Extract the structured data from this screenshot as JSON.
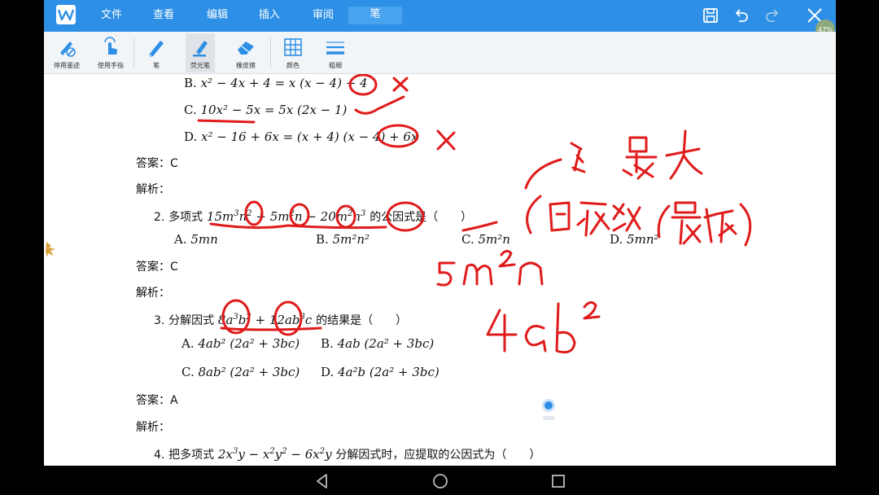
{
  "app": {
    "menu_tabs": [
      "文件",
      "查看",
      "编辑",
      "插入",
      "审阅",
      "笔"
    ],
    "active_tab": "笔",
    "zoom_badge": "47%",
    "accent_color": "#2d8fe6"
  },
  "toolbar": {
    "tools": [
      {
        "label": "停用墨迹",
        "icon": "pen-disable-icon"
      },
      {
        "label": "使用手指",
        "icon": "finger-icon"
      },
      {
        "label": "笔",
        "icon": "pen-icon"
      },
      {
        "label": "荧光笔",
        "icon": "highlighter-icon",
        "selected": true
      },
      {
        "label": "橡皮擦",
        "icon": "eraser-icon"
      },
      {
        "label": "颜色",
        "icon": "color-grid-icon"
      },
      {
        "label": "粗细",
        "icon": "line-width-icon"
      }
    ]
  },
  "document": {
    "q1": {
      "option_b": {
        "label": "B.",
        "expr": "x² − 4x + 4 = x (x − 4) + 4"
      },
      "option_c": {
        "label": "C.",
        "expr": "10x² − 5x = 5x (2x − 1)"
      },
      "option_d": {
        "label": "D.",
        "expr": "x² − 16 + 6x = (x + 4) (x − 4) + 6x"
      },
      "answer_label": "答案：",
      "answer": "C",
      "analysis_label": "解析："
    },
    "q2": {
      "number": "2.",
      "stem_prefix": "多项式",
      "stem_suffix": "的公因式是（　　）",
      "options": [
        {
          "label": "A.",
          "value": "5mn"
        },
        {
          "label": "B.",
          "value": "5m²n²"
        },
        {
          "label": "C.",
          "value": "5m²n"
        },
        {
          "label": "D.",
          "value": "5mn²"
        }
      ],
      "answer_label": "答案：",
      "answer": "C",
      "analysis_label": "解析："
    },
    "q3": {
      "number": "3.",
      "stem_prefix": "分解因式",
      "stem_suffix": "的结果是（　　）",
      "options": [
        {
          "label": "A.",
          "value": "4ab² (2a² + 3bc)"
        },
        {
          "label": "B.",
          "value": "4ab (2a² + 3bc)"
        },
        {
          "label": "C.",
          "value": "8ab² (2a² + 3bc)"
        },
        {
          "label": "D.",
          "value": "4a²b (2a² + 3bc)"
        }
      ],
      "answer_label": "答案：",
      "answer": "A",
      "analysis_label": "解析："
    },
    "q4": {
      "number": "4.",
      "stem_prefix": "把多项式",
      "stem_suffix": "分解因式时，应提取的公因式为（　　）"
    }
  }
}
